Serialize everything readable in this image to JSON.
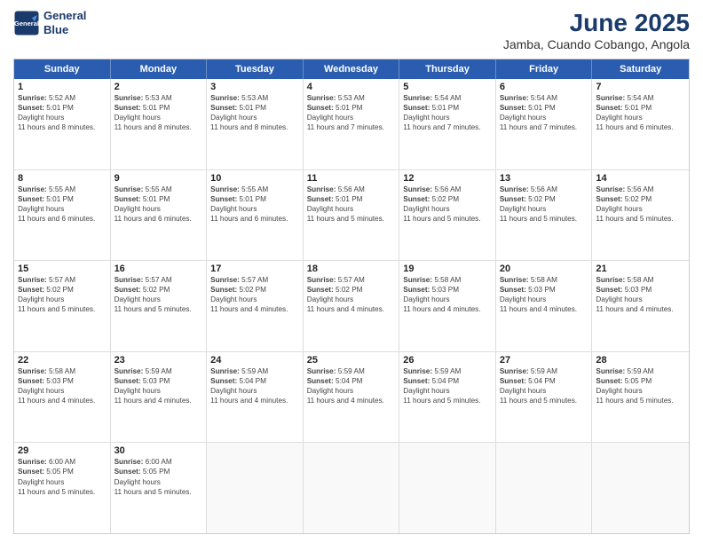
{
  "header": {
    "logo_line1": "General",
    "logo_line2": "Blue",
    "month": "June 2025",
    "location": "Jamba, Cuando Cobango, Angola"
  },
  "days_of_week": [
    "Sunday",
    "Monday",
    "Tuesday",
    "Wednesday",
    "Thursday",
    "Friday",
    "Saturday"
  ],
  "weeks": [
    [
      {
        "day": "1",
        "sunrise": "5:52 AM",
        "sunset": "5:01 PM",
        "daylight": "11 hours and 8 minutes."
      },
      {
        "day": "2",
        "sunrise": "5:53 AM",
        "sunset": "5:01 PM",
        "daylight": "11 hours and 8 minutes."
      },
      {
        "day": "3",
        "sunrise": "5:53 AM",
        "sunset": "5:01 PM",
        "daylight": "11 hours and 8 minutes."
      },
      {
        "day": "4",
        "sunrise": "5:53 AM",
        "sunset": "5:01 PM",
        "daylight": "11 hours and 7 minutes."
      },
      {
        "day": "5",
        "sunrise": "5:54 AM",
        "sunset": "5:01 PM",
        "daylight": "11 hours and 7 minutes."
      },
      {
        "day": "6",
        "sunrise": "5:54 AM",
        "sunset": "5:01 PM",
        "daylight": "11 hours and 7 minutes."
      },
      {
        "day": "7",
        "sunrise": "5:54 AM",
        "sunset": "5:01 PM",
        "daylight": "11 hours and 6 minutes."
      }
    ],
    [
      {
        "day": "8",
        "sunrise": "5:55 AM",
        "sunset": "5:01 PM",
        "daylight": "11 hours and 6 minutes."
      },
      {
        "day": "9",
        "sunrise": "5:55 AM",
        "sunset": "5:01 PM",
        "daylight": "11 hours and 6 minutes."
      },
      {
        "day": "10",
        "sunrise": "5:55 AM",
        "sunset": "5:01 PM",
        "daylight": "11 hours and 6 minutes."
      },
      {
        "day": "11",
        "sunrise": "5:56 AM",
        "sunset": "5:01 PM",
        "daylight": "11 hours and 5 minutes."
      },
      {
        "day": "12",
        "sunrise": "5:56 AM",
        "sunset": "5:02 PM",
        "daylight": "11 hours and 5 minutes."
      },
      {
        "day": "13",
        "sunrise": "5:56 AM",
        "sunset": "5:02 PM",
        "daylight": "11 hours and 5 minutes."
      },
      {
        "day": "14",
        "sunrise": "5:56 AM",
        "sunset": "5:02 PM",
        "daylight": "11 hours and 5 minutes."
      }
    ],
    [
      {
        "day": "15",
        "sunrise": "5:57 AM",
        "sunset": "5:02 PM",
        "daylight": "11 hours and 5 minutes."
      },
      {
        "day": "16",
        "sunrise": "5:57 AM",
        "sunset": "5:02 PM",
        "daylight": "11 hours and 5 minutes."
      },
      {
        "day": "17",
        "sunrise": "5:57 AM",
        "sunset": "5:02 PM",
        "daylight": "11 hours and 4 minutes."
      },
      {
        "day": "18",
        "sunrise": "5:57 AM",
        "sunset": "5:02 PM",
        "daylight": "11 hours and 4 minutes."
      },
      {
        "day": "19",
        "sunrise": "5:58 AM",
        "sunset": "5:03 PM",
        "daylight": "11 hours and 4 minutes."
      },
      {
        "day": "20",
        "sunrise": "5:58 AM",
        "sunset": "5:03 PM",
        "daylight": "11 hours and 4 minutes."
      },
      {
        "day": "21",
        "sunrise": "5:58 AM",
        "sunset": "5:03 PM",
        "daylight": "11 hours and 4 minutes."
      }
    ],
    [
      {
        "day": "22",
        "sunrise": "5:58 AM",
        "sunset": "5:03 PM",
        "daylight": "11 hours and 4 minutes."
      },
      {
        "day": "23",
        "sunrise": "5:59 AM",
        "sunset": "5:03 PM",
        "daylight": "11 hours and 4 minutes."
      },
      {
        "day": "24",
        "sunrise": "5:59 AM",
        "sunset": "5:04 PM",
        "daylight": "11 hours and 4 minutes."
      },
      {
        "day": "25",
        "sunrise": "5:59 AM",
        "sunset": "5:04 PM",
        "daylight": "11 hours and 4 minutes."
      },
      {
        "day": "26",
        "sunrise": "5:59 AM",
        "sunset": "5:04 PM",
        "daylight": "11 hours and 5 minutes."
      },
      {
        "day": "27",
        "sunrise": "5:59 AM",
        "sunset": "5:04 PM",
        "daylight": "11 hours and 5 minutes."
      },
      {
        "day": "28",
        "sunrise": "5:59 AM",
        "sunset": "5:05 PM",
        "daylight": "11 hours and 5 minutes."
      }
    ],
    [
      {
        "day": "29",
        "sunrise": "6:00 AM",
        "sunset": "5:05 PM",
        "daylight": "11 hours and 5 minutes."
      },
      {
        "day": "30",
        "sunrise": "6:00 AM",
        "sunset": "5:05 PM",
        "daylight": "11 hours and 5 minutes."
      },
      {
        "day": "",
        "sunrise": "",
        "sunset": "",
        "daylight": ""
      },
      {
        "day": "",
        "sunrise": "",
        "sunset": "",
        "daylight": ""
      },
      {
        "day": "",
        "sunrise": "",
        "sunset": "",
        "daylight": ""
      },
      {
        "day": "",
        "sunrise": "",
        "sunset": "",
        "daylight": ""
      },
      {
        "day": "",
        "sunrise": "",
        "sunset": "",
        "daylight": ""
      }
    ]
  ],
  "labels": {
    "sunrise": "Sunrise:",
    "sunset": "Sunset:",
    "daylight": "Daylight hours"
  }
}
